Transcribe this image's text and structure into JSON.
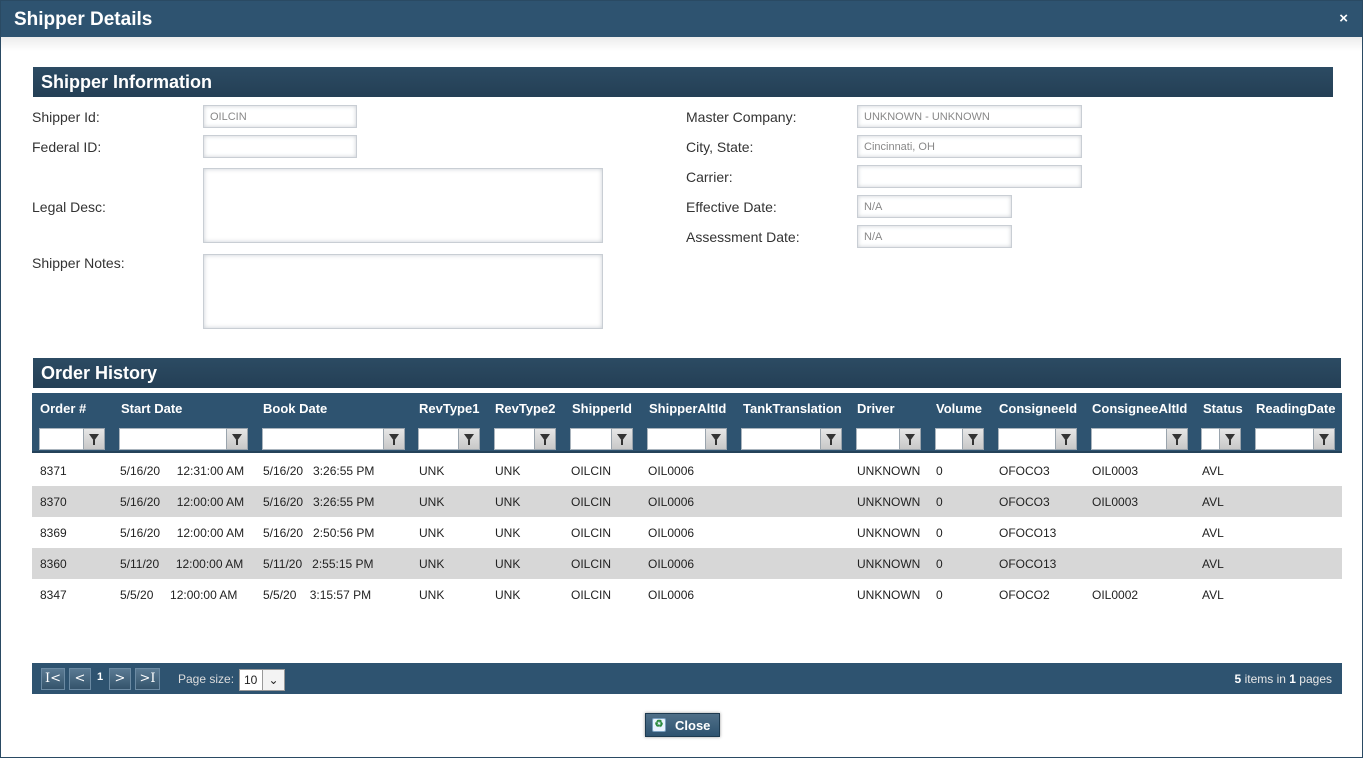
{
  "window": {
    "title": "Shipper Details",
    "close_glyph": "×"
  },
  "shipper_info": {
    "header": "Shipper Information",
    "shipper_id_label": "Shipper Id:",
    "shipper_id_value": "OILCIN",
    "federal_id_label": "Federal ID:",
    "federal_id_value": "",
    "legal_desc_label": "Legal Desc:",
    "shipper_notes_label": "Shipper Notes:",
    "master_company_label": "Master Company:",
    "master_company_value": "UNKNOWN - UNKNOWN",
    "city_state_label": "City, State:",
    "city_state_value": "Cincinnati, OH",
    "carrier_label": "Carrier:",
    "carrier_value": "",
    "effective_date_label": "Effective Date:",
    "effective_date_value": "N/A",
    "assessment_date_label": "Assessment Date:",
    "assessment_date_value": "N/A"
  },
  "order_history": {
    "header": "Order History",
    "columns": [
      "Order #",
      "Start Date",
      "Book Date",
      "RevType1",
      "RevType2",
      "ShipperId",
      "ShipperAltId",
      "TankTranslation",
      "Driver",
      "Volume",
      "ConsigneeId",
      "ConsigneeAltId",
      "Status",
      "ReadingDate"
    ],
    "rows": [
      [
        "8371",
        "5/16/20     12:31:00 AM",
        "5/16/20   3:26:55 PM",
        "UNK",
        "UNK",
        "OILCIN",
        "OIL0006",
        "",
        "UNKNOWN",
        "0",
        "OFOCO3",
        "OIL0003",
        "AVL",
        ""
      ],
      [
        "8370",
        "5/16/20     12:00:00 AM",
        "5/16/20   3:26:55 PM",
        "UNK",
        "UNK",
        "OILCIN",
        "OIL0006",
        "",
        "UNKNOWN",
        "0",
        "OFOCO3",
        "OIL0003",
        "AVL",
        ""
      ],
      [
        "8369",
        "5/16/20     12:00:00 AM",
        "5/16/20   2:50:56 PM",
        "UNK",
        "UNK",
        "OILCIN",
        "OIL0006",
        "",
        "UNKNOWN",
        "0",
        "OFOCO13",
        "",
        "AVL",
        ""
      ],
      [
        "8360",
        "5/11/20     12:00:00 AM",
        "5/11/20   2:55:15 PM",
        "UNK",
        "UNK",
        "OILCIN",
        "OIL0006",
        "",
        "UNKNOWN",
        "0",
        "OFOCO13",
        "",
        "AVL",
        ""
      ],
      [
        "8347",
        "5/5/20     12:00:00 AM",
        "5/5/20    3:15:57 PM",
        "UNK",
        "UNK",
        "OILCIN",
        "OIL0006",
        "",
        "UNKNOWN",
        "0",
        "OFOCO2",
        "OIL0002",
        "AVL",
        ""
      ]
    ]
  },
  "pager": {
    "first": "I<",
    "prev": "<",
    "next": ">",
    "last": ">I",
    "current_page": "1",
    "page_size_label": "Page size:",
    "page_size_value": "10",
    "items_count": "5",
    "items_text": "items in",
    "pages_count": "1",
    "pages_text": "pages"
  },
  "footer": {
    "close_label": "Close"
  },
  "colors": {
    "header_bg": "#2e5370",
    "alt_row": "#d7d7d7"
  }
}
